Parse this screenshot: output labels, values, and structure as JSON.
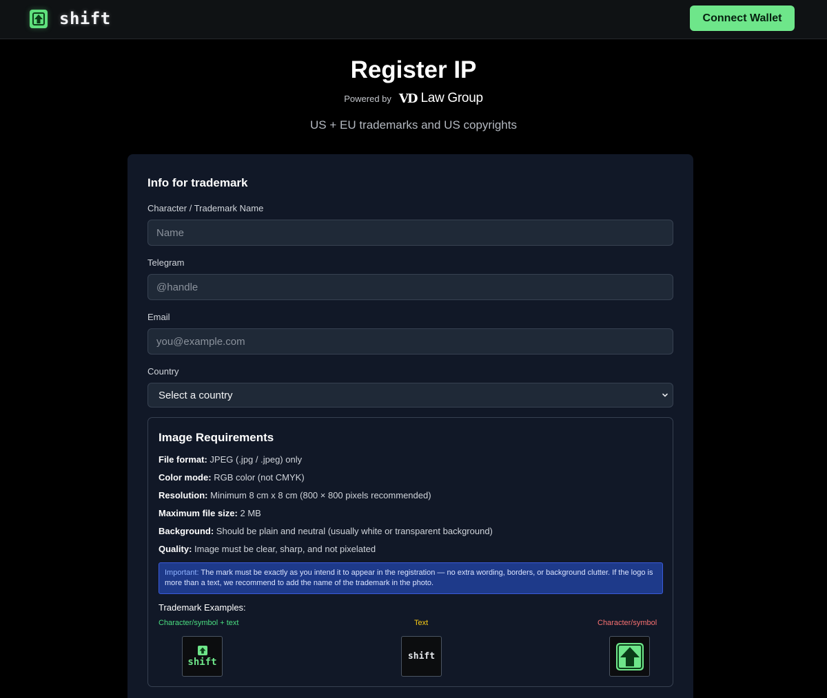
{
  "header": {
    "logo_text": "shift",
    "connect_button": "Connect Wallet"
  },
  "hero": {
    "title": "Register IP",
    "powered_by": "Powered by",
    "partner_mark": "VD",
    "partner_name": "Law Group",
    "subtitle": "US + EU trademarks and US copyrights"
  },
  "form": {
    "title": "Info for trademark",
    "fields": {
      "name": {
        "label": "Character / Trademark Name",
        "placeholder": "Name"
      },
      "telegram": {
        "label": "Telegram",
        "placeholder": "@handle"
      },
      "email": {
        "label": "Email",
        "placeholder": "you@example.com"
      },
      "country": {
        "label": "Country",
        "value": "Select a country"
      }
    }
  },
  "requirements": {
    "title": "Image Requirements",
    "items": [
      {
        "key": "File format:",
        "value": "JPEG (.jpg / .jpeg) only"
      },
      {
        "key": "Color mode:",
        "value": "RGB color (not CMYK)"
      },
      {
        "key": "Resolution:",
        "value": "Minimum 8 cm x 8 cm (800 × 800 pixels recommended)"
      },
      {
        "key": "Maximum file size:",
        "value": "2 MB"
      },
      {
        "key": "Background:",
        "value": "Should be plain and neutral (usually white or transparent background)"
      },
      {
        "key": "Quality:",
        "value": "Image must be clear, sharp, and not pixelated"
      }
    ],
    "notice_label": "Important:",
    "notice_text": "The mark must be exactly as you intend it to appear in the registration — no extra wording, borders, or background clutter. If the logo is more than a text, we recommend to add the name of the trademark in the photo.",
    "examples_title": "Trademark Examples:",
    "examples": [
      {
        "label": "Character/symbol + text",
        "tile_text": "shift",
        "color": "#4ade80"
      },
      {
        "label": "Text",
        "tile_text": "shift",
        "color": "#facc15"
      },
      {
        "label": "Character/symbol",
        "color": "#f87171"
      }
    ]
  },
  "colors": {
    "accent": "#6ee68a",
    "card_bg": "#111827",
    "input_bg": "#1f2937",
    "notice_bg": "#1e3a8a"
  }
}
